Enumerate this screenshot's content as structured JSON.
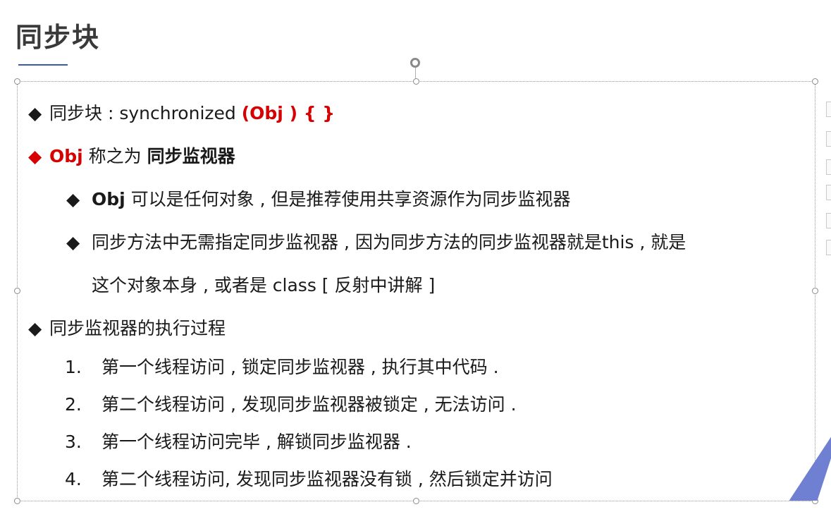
{
  "slide": {
    "title": "同步块",
    "bullets": [
      {
        "marker": "◆",
        "parts": [
          "同步块 : synchronized ",
          "(Obj ) { }"
        ]
      },
      {
        "marker": "◆",
        "parts": [
          "Obj",
          " 称之为 ",
          "同步监视器"
        ]
      },
      {
        "marker": "◆",
        "parts": [
          "Obj",
          " 可以是任何对象 , 但是推荐使用共享资源作为同步监视器"
        ]
      },
      {
        "marker": "◆",
        "line1": "同步方法中无需指定同步监视器 , 因为同步方法的同步监视器就是this , 就是",
        "line2": "这个对象本身 , 或者是 class [ 反射中讲解 ]"
      },
      {
        "marker": "◆",
        "text": "同步监视器的执行过程"
      }
    ],
    "steps": [
      {
        "num": "1.",
        "text": "第一个线程访问 , 锁定同步监视器 , 执行其中代码 ."
      },
      {
        "num": "2.",
        "text": "第二个线程访问 , 发现同步监视器被锁定 , 无法访问 ."
      },
      {
        "num": "3.",
        "text": "第一个线程访问完毕 , 解锁同步监视器 ."
      },
      {
        "num": "4.",
        "text": "第二个线程访问, 发现同步监视器没有锁 , 然后锁定并访问"
      }
    ]
  },
  "colors": {
    "accent_red": "#d60000",
    "title_gray": "#3a3a3a",
    "underline_blue": "#3b5aa8",
    "corner_blue": "#6f7fd1"
  }
}
